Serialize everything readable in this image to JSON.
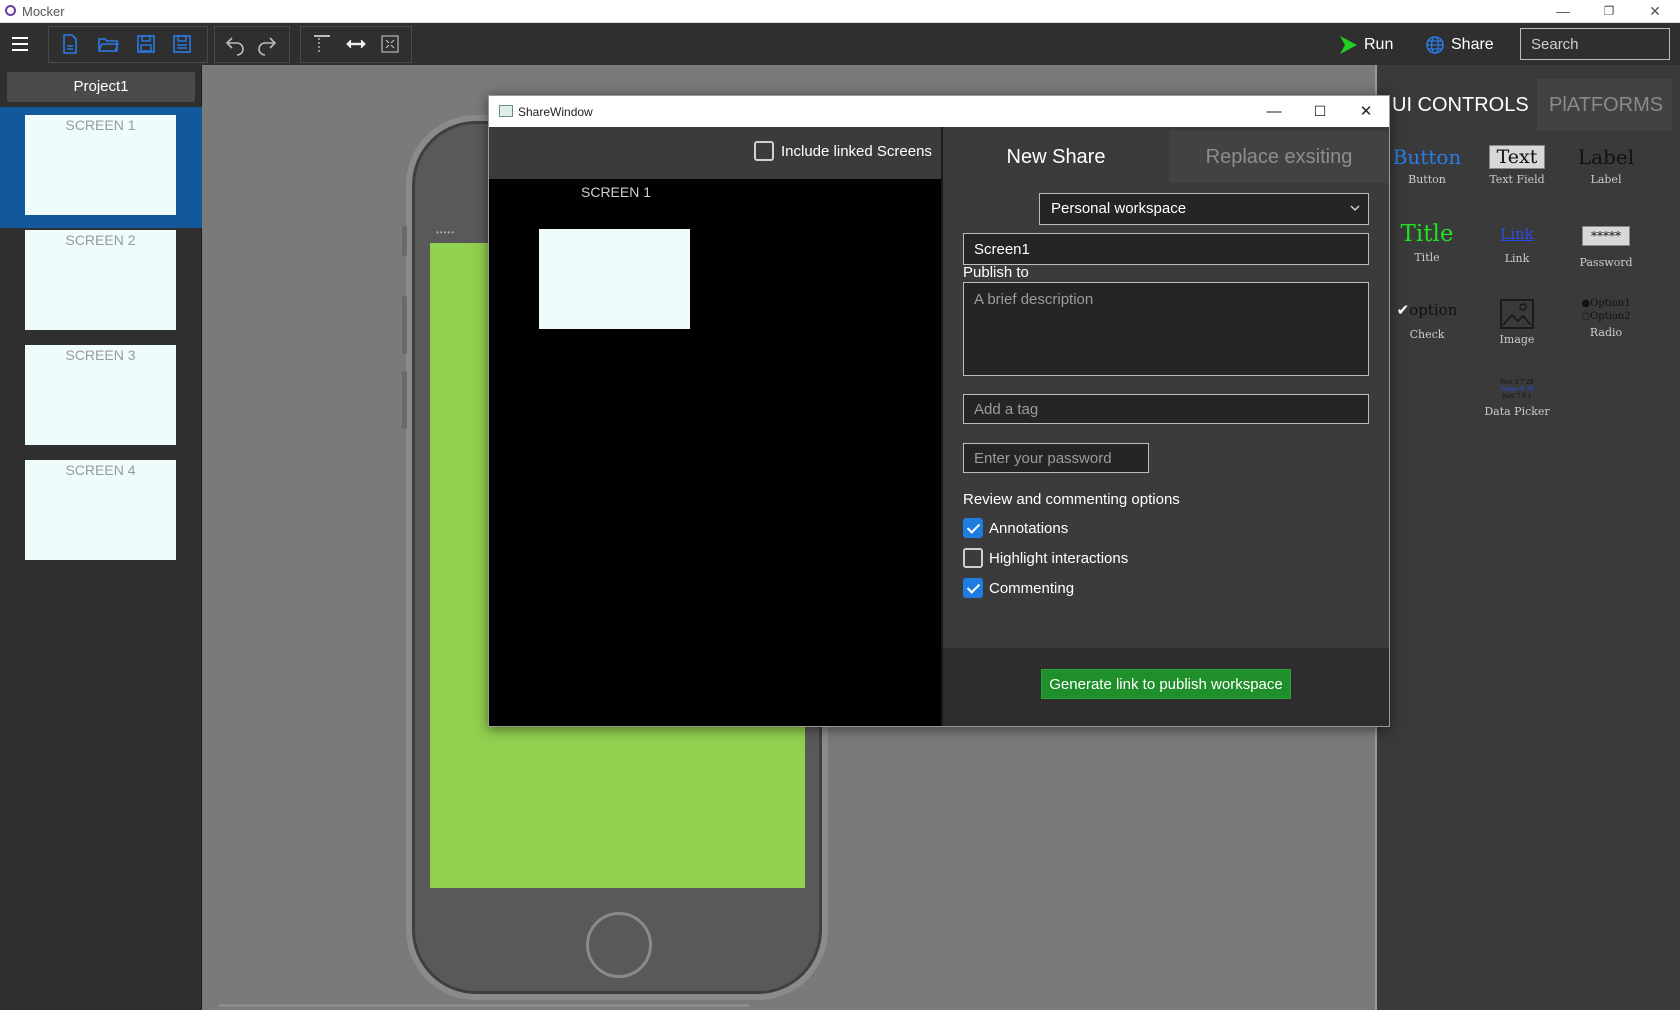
{
  "app": {
    "title": "Mocker",
    "win_min": "—",
    "win_restore": "❐",
    "win_close": "✕"
  },
  "toolbar": {
    "icons": [
      "menu-icon",
      "new-file-icon",
      "open-folder-icon",
      "save-icon",
      "save-as-icon",
      "undo-icon",
      "redo-icon",
      "align-top-icon",
      "align-horizontal-icon",
      "fit-screen-icon"
    ],
    "run_label": "Run",
    "share_label": "Share",
    "search_placeholder": "Search",
    "accent_run": "#20d020",
    "accent_share": "#2a7be4"
  },
  "project": {
    "name": "Project1",
    "screens": [
      {
        "label": "SCREEN 1",
        "selected": true
      },
      {
        "label": "SCREEN 2",
        "selected": false
      },
      {
        "label": "SCREEN 3",
        "selected": false
      },
      {
        "label": "SCREEN 4",
        "selected": false
      }
    ]
  },
  "canvas": {
    "phone_screen_color": "#92d050",
    "speaker_dots": "•••••"
  },
  "right_panel": {
    "tabs": {
      "ui_controls": "UI CONTROLS",
      "platforms": "PlATFORMS"
    },
    "controls": [
      {
        "name": "button",
        "preview": "Button",
        "caption": "Button"
      },
      {
        "name": "text-field",
        "preview": "Text",
        "caption": "Text Field"
      },
      {
        "name": "label",
        "preview": "Label",
        "caption": "Label"
      },
      {
        "name": "title",
        "preview": "Title",
        "caption": "Title"
      },
      {
        "name": "link",
        "preview": "Link",
        "caption": "Link"
      },
      {
        "name": "password",
        "preview": "*****",
        "caption": "Password"
      },
      {
        "name": "check",
        "preview": "option",
        "caption": "Check"
      },
      {
        "name": "image",
        "preview": "",
        "caption": "Image"
      },
      {
        "name": "radio",
        "preview_1": "Option1",
        "preview_2": "Option2",
        "caption": "Radio"
      },
      {
        "name": "data-picker",
        "preview_1": "Nov 3  7  29",
        "preview_2": "Today 8  30",
        "preview_3": "Nov 7  9  1",
        "caption": "Data Picker"
      }
    ]
  },
  "share_window": {
    "title": "ShareWindow",
    "include_linked_label": "Include linked Screens",
    "include_linked_checked": false,
    "preview_label": "SCREEN 1",
    "tabs": {
      "new_share": "New Share",
      "replace": "Replace exsiting"
    },
    "publish_to_label": "Publish to",
    "publish_to_value": "Personal workspace",
    "name_value": "Screen1",
    "description_placeholder": "A brief description",
    "tag_placeholder": "Add a tag",
    "password_placeholder": "Enter your password",
    "review_heading": "Review and commenting options",
    "options": [
      {
        "label": "Annotations",
        "checked": true
      },
      {
        "label": "Highlight interactions",
        "checked": false
      },
      {
        "label": "Commenting",
        "checked": true
      }
    ],
    "generate_label": "Generate link to publish workspace",
    "generate_color": "#1f8f2c"
  }
}
